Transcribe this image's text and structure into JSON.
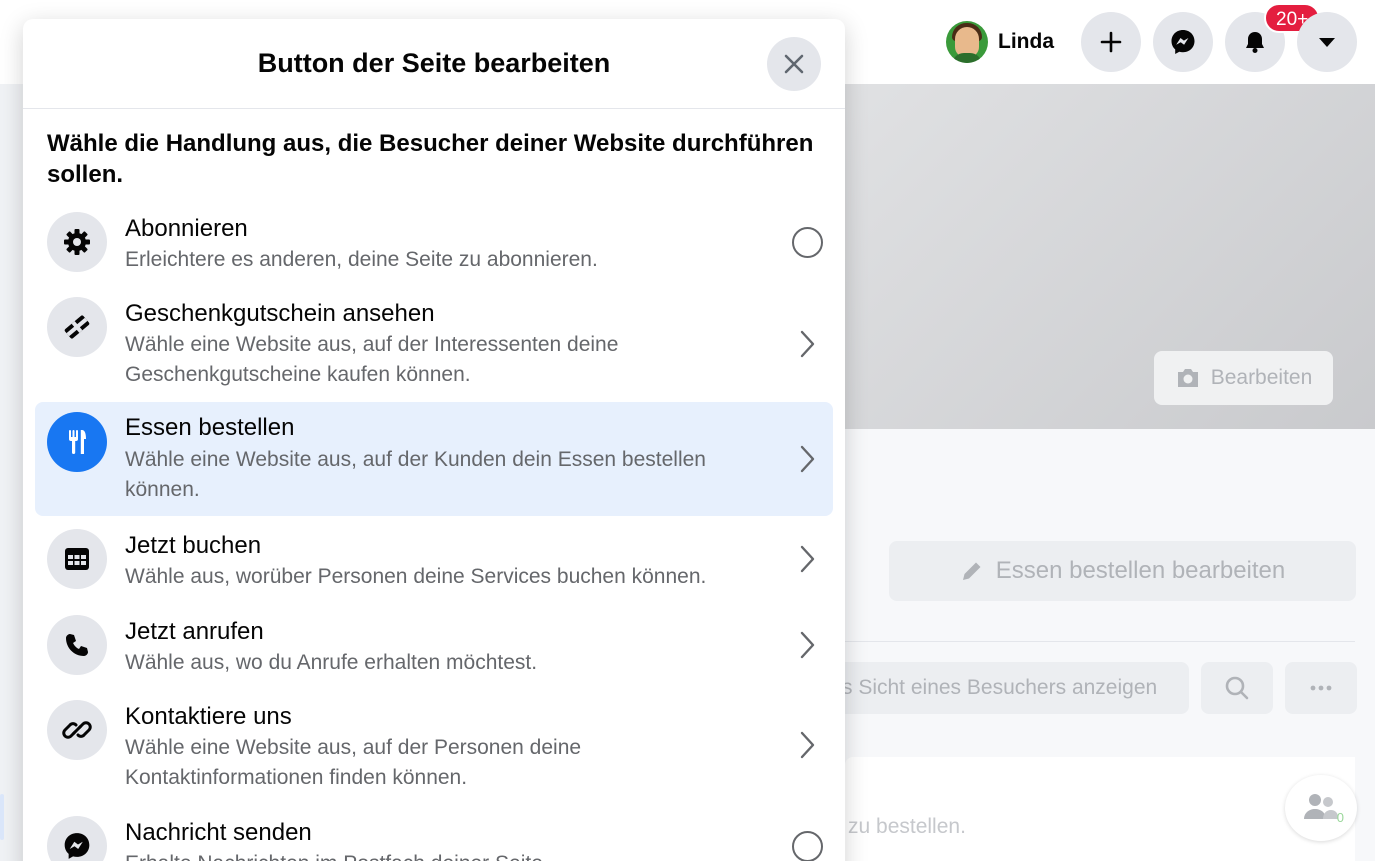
{
  "topbar": {
    "profile_name": "Linda",
    "notifications_badge": "20+",
    "icons": [
      "plus-icon",
      "messenger-icon",
      "bell-icon",
      "caret-down-icon"
    ]
  },
  "background": {
    "cover_edit_label": "Bearbeiten",
    "cta_edit_label": "Essen bestellen bearbeiten",
    "visitor_view_label": "s Sicht eines Besuchers anzeigen",
    "order_hint": "zu bestellen.",
    "people_count": "0"
  },
  "modal": {
    "title": "Button der Seite bearbeiten",
    "question": "Wähle die Handlung aus, die Besucher deiner Website durchführen sollen.",
    "options": [
      {
        "title": "Abonnieren",
        "description": "Erleichtere es anderen, deine Seite zu abonnieren.",
        "icon": "gear-icon",
        "control": "radio"
      },
      {
        "title": "Geschenkgutschein ansehen",
        "description": "Wähle eine Website aus, auf der Interessenten deine Geschenkgutscheine kaufen können.",
        "icon": "gift-card-icon",
        "control": "chevron"
      },
      {
        "title": "Essen bestellen",
        "description": "Wähle eine Website aus, auf der Kunden dein Essen bestellen können.",
        "icon": "fork-knife-icon",
        "control": "chevron",
        "selected": true
      },
      {
        "title": "Jetzt buchen",
        "description": "Wähle aus, worüber Personen deine Services buchen können.",
        "icon": "calendar-icon",
        "control": "chevron"
      },
      {
        "title": "Jetzt anrufen",
        "description": "Wähle aus, wo du Anrufe erhalten möchtest.",
        "icon": "phone-icon",
        "control": "chevron"
      },
      {
        "title": "Kontaktiere uns",
        "description": "Wähle eine Website aus, auf der Personen deine Kontaktinformationen finden können.",
        "icon": "link-icon",
        "control": "chevron"
      },
      {
        "title": "Nachricht senden",
        "description": "Erhalte Nachrichten im Postfach deiner Seite",
        "icon": "messenger-icon",
        "control": "radio"
      }
    ]
  },
  "colors": {
    "accent": "#1877f2",
    "selected_bg": "#e7f0fd",
    "badge": "#e41e3f",
    "secondary_text": "#65676b"
  }
}
